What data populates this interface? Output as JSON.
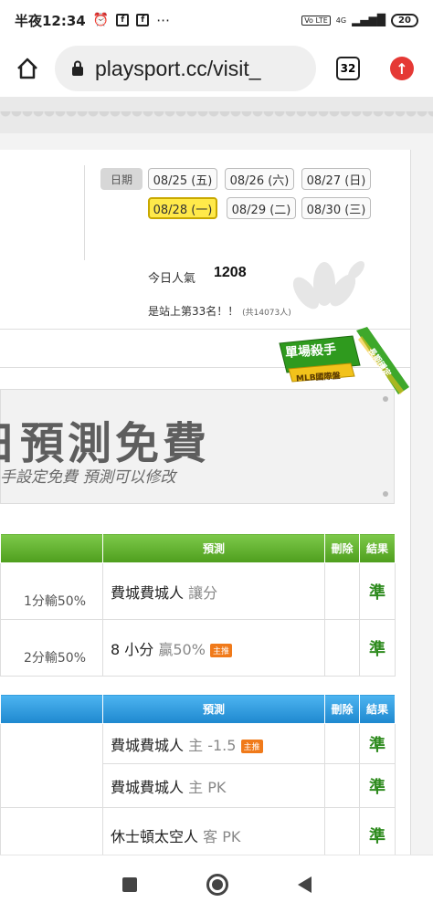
{
  "status_bar": {
    "time": "半夜12:34",
    "battery": "20",
    "network": "4G"
  },
  "browser": {
    "url": "playsport.cc/visit_",
    "tab_count": "32"
  },
  "dates": {
    "label": "日期",
    "items": [
      "08/25 (五)",
      "08/26 (六)",
      "08/27 (日)",
      "08/28 (一)",
      "08/29 (二)",
      "08/30 (三)"
    ],
    "selected": "08/28 (一)"
  },
  "popularity": {
    "label": "今日人氣",
    "value": "1208",
    "rank_text": "是站上第33名！！",
    "rank_sub": "(共14073人)"
  },
  "badge": {
    "main": "單場殺手",
    "sub": "MLB國際盤",
    "ribbon": "長期穩定"
  },
  "banner": {
    "title": "日預測免費",
    "subtitle": "手設定免費 預測可以修改"
  },
  "table1": {
    "headers": [
      "預測",
      "刪除",
      "結果"
    ],
    "rows": [
      {
        "score": "1分輸50%",
        "pick": "費城費城人",
        "pick_extra": "讓分",
        "tag": "",
        "result": "準"
      },
      {
        "score": "2分輸50%",
        "pick": "8 小分",
        "pick_extra": "贏50%",
        "tag": "主推",
        "result": "準"
      }
    ]
  },
  "table2": {
    "headers": [
      "預測",
      "刪除",
      "結果"
    ],
    "rows": [
      {
        "pick": "費城費城人",
        "pick_extra": "主 -1.5",
        "tag": "主推",
        "result": "準"
      },
      {
        "pick": "費城費城人",
        "pick_extra": "主 PK",
        "tag": "",
        "result": "準"
      },
      {
        "pick": "休士頓太空人",
        "pick_extra": "客 PK",
        "tag": "",
        "result": "準"
      }
    ]
  },
  "colors": {
    "green_header": "#5ea82a",
    "blue_header": "#2a95d8",
    "result_green": "#2e8b1e",
    "tag_orange": "#f07a1a",
    "selected_date": "#ffe94a"
  }
}
